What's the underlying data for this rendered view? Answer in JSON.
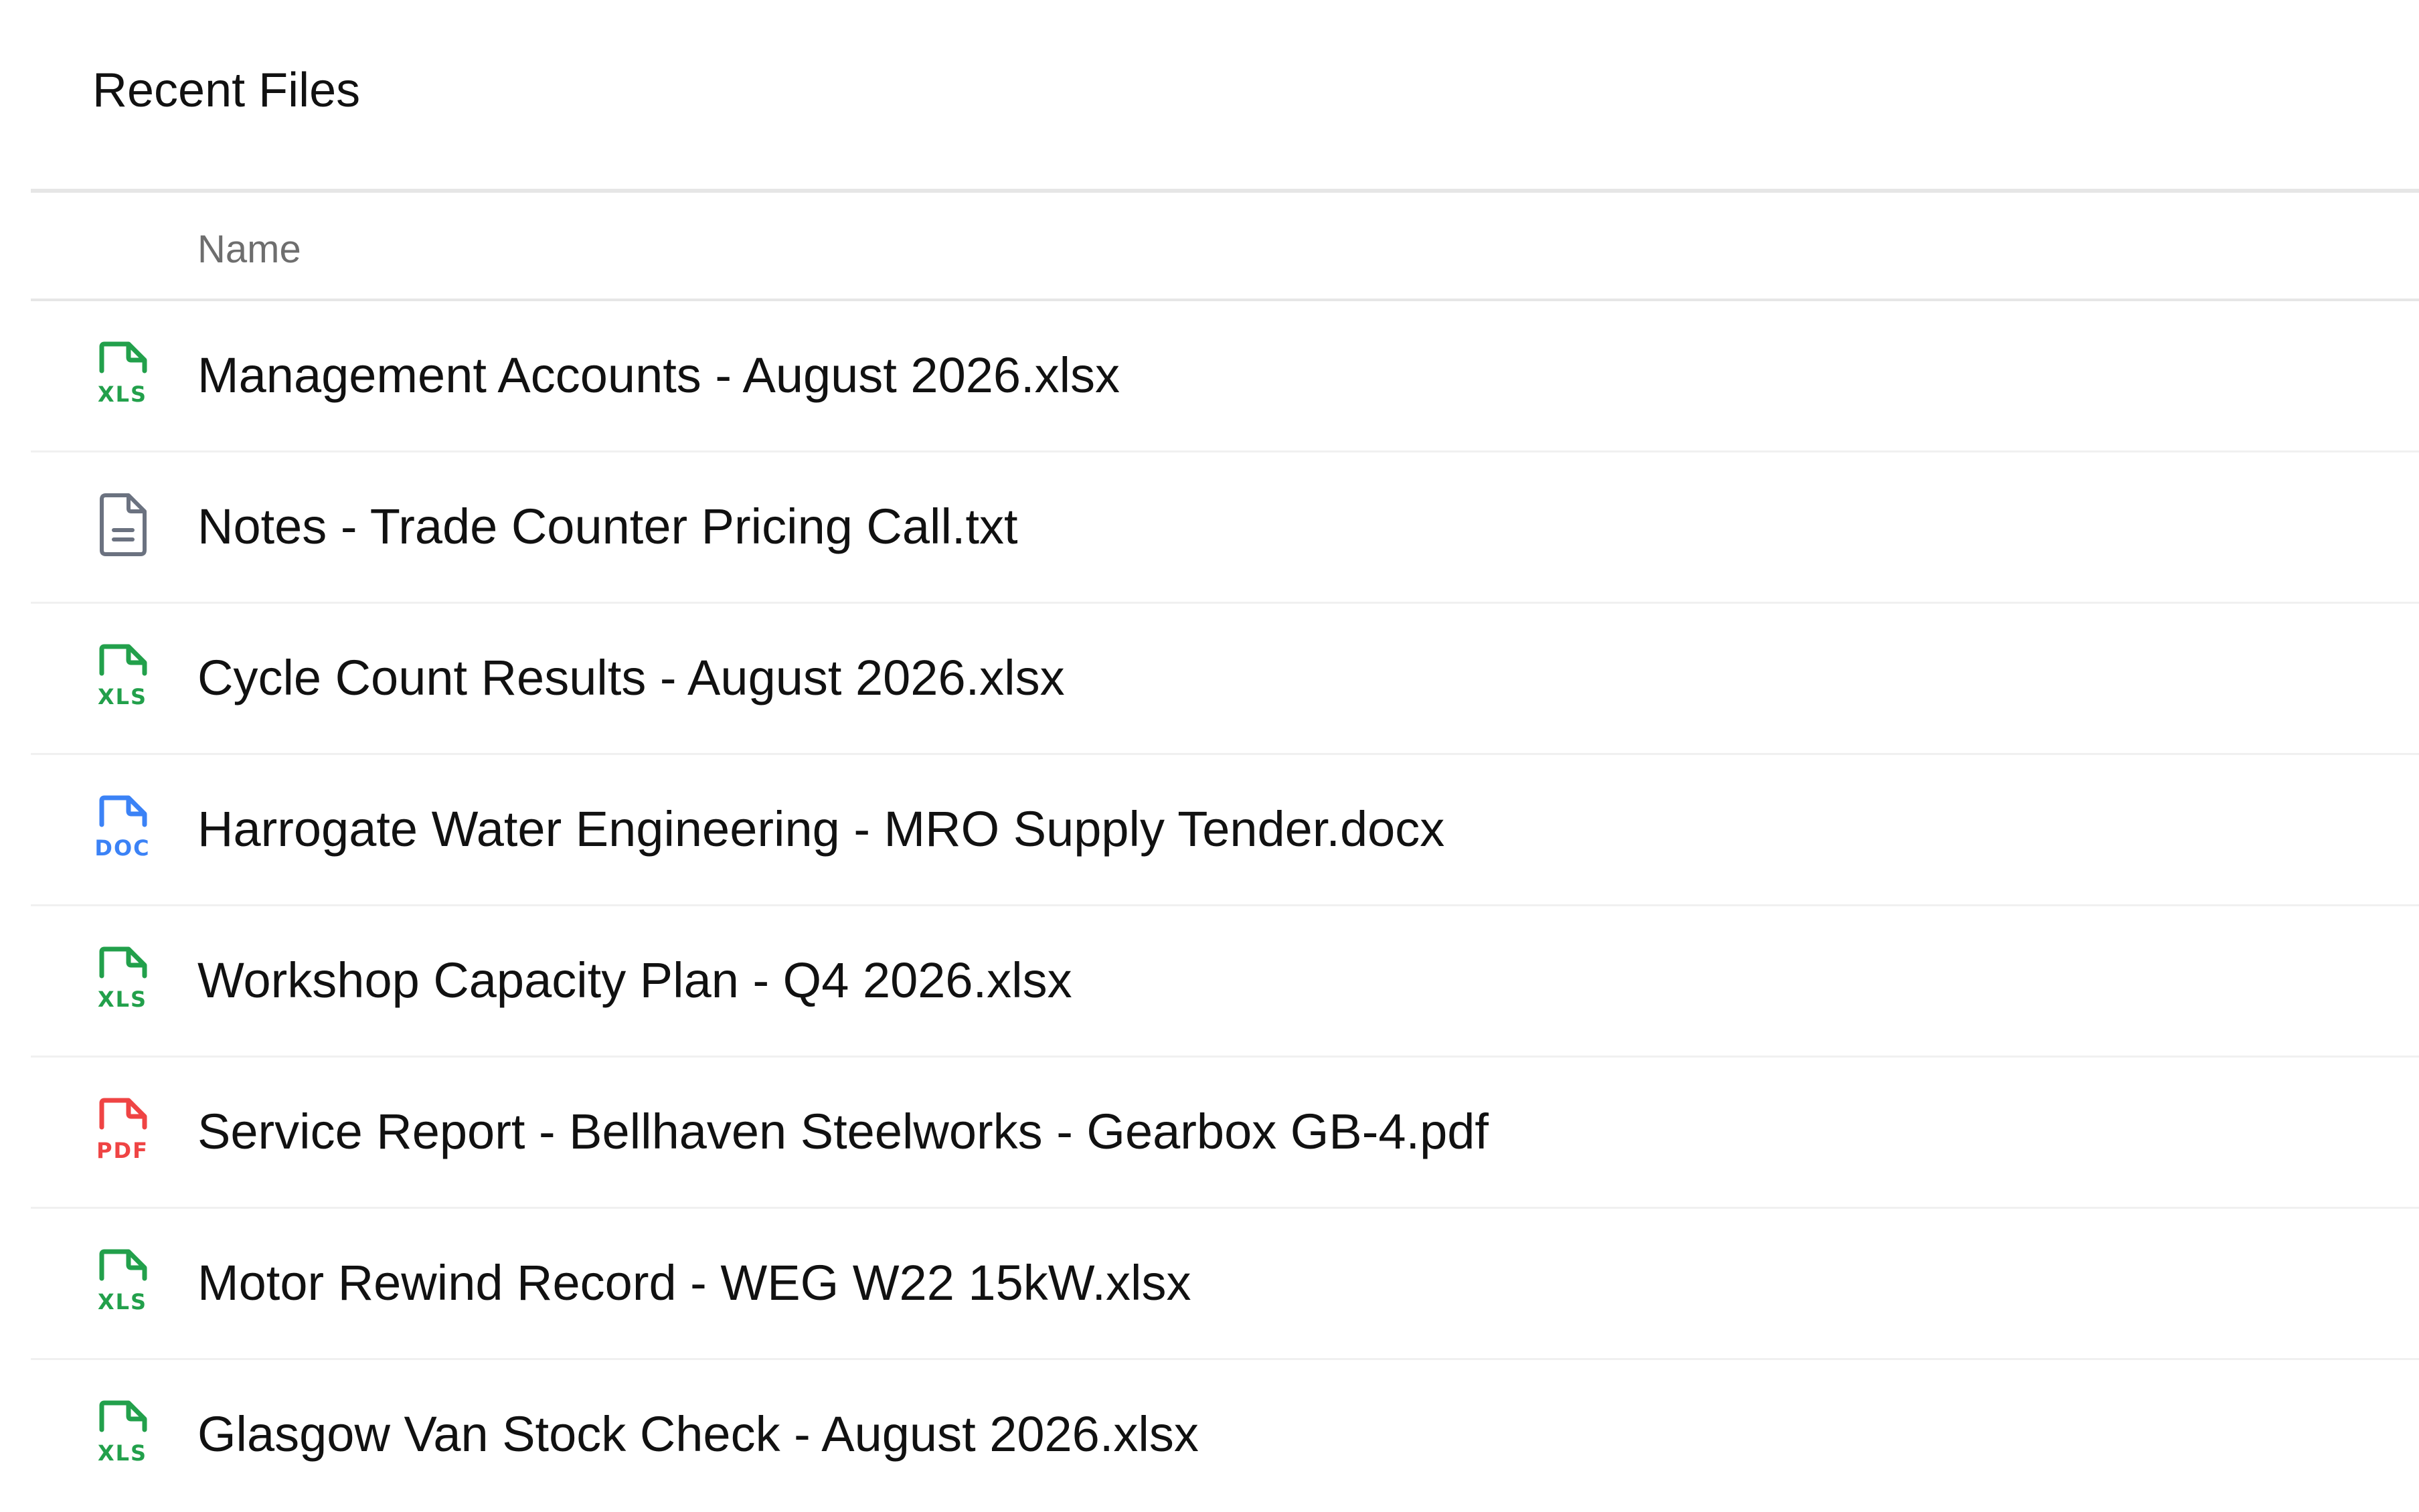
{
  "header": {
    "title": "Recent Files"
  },
  "table": {
    "column_name": "Name"
  },
  "files": [
    {
      "name": "Management Accounts - August 2026.xlsx",
      "icon": "xls-file-icon",
      "badge": "XLS",
      "color": "#22a04b"
    },
    {
      "name": "Notes - Trade Counter Pricing Call.txt",
      "icon": "text-file-icon",
      "badge": "",
      "color": "#6b7280"
    },
    {
      "name": "Cycle Count Results - August 2026.xlsx",
      "icon": "xls-file-icon",
      "badge": "XLS",
      "color": "#22a04b"
    },
    {
      "name": "Harrogate Water Engineering - MRO Supply Tender.docx",
      "icon": "doc-file-icon",
      "badge": "DOC",
      "color": "#3b82f6"
    },
    {
      "name": "Workshop Capacity Plan - Q4 2026.xlsx",
      "icon": "xls-file-icon",
      "badge": "XLS",
      "color": "#22a04b"
    },
    {
      "name": "Service Report - Bellhaven Steelworks - Gearbox GB-4.pdf",
      "icon": "pdf-file-icon",
      "badge": "PDF",
      "color": "#ef4444"
    },
    {
      "name": "Motor Rewind Record - WEG W22 15kW.xlsx",
      "icon": "xls-file-icon",
      "badge": "XLS",
      "color": "#22a04b"
    },
    {
      "name": "Glasgow Van Stock Check - August 2026.xlsx",
      "icon": "xls-file-icon",
      "badge": "XLS",
      "color": "#22a04b"
    }
  ]
}
